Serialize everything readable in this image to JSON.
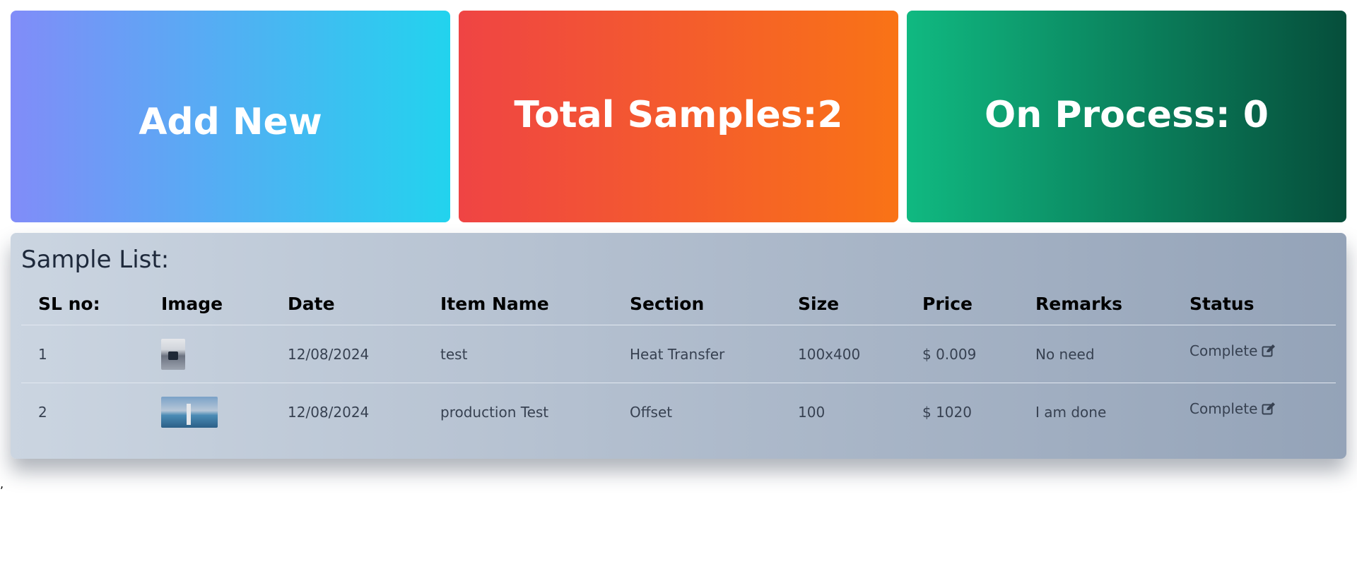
{
  "cards": {
    "add_new": "Add New",
    "total_samples": "Total Samples:2",
    "on_process": "On Process: 0"
  },
  "sample_list": {
    "title": "Sample List:",
    "columns": [
      "SL no:",
      "Image",
      "Date",
      "Item Name",
      "Section",
      "Size",
      "Price",
      "Remarks",
      "Status"
    ],
    "rows": [
      {
        "sl": "1",
        "image": "sample-image-1",
        "date": "12/08/2024",
        "item_name": "test",
        "section": "Heat Transfer",
        "size": "100x400",
        "price": "$ 0.009",
        "remarks": "No need",
        "status": "Complete"
      },
      {
        "sl": "2",
        "image": "sample-image-2",
        "date": "12/08/2024",
        "item_name": "production Test",
        "section": "Offset",
        "size": "100",
        "price": "$ 1020",
        "remarks": "I am done",
        "status": "Complete"
      }
    ]
  },
  "stray_mark": ",",
  "icons": {
    "status": "edit-icon"
  },
  "colors": {
    "add_new_start": "#818cf8",
    "add_new_end": "#22d3ee",
    "total_start": "#ef4444",
    "total_end": "#f97316",
    "process_start": "#10b981",
    "process_end": "#064e3b"
  }
}
